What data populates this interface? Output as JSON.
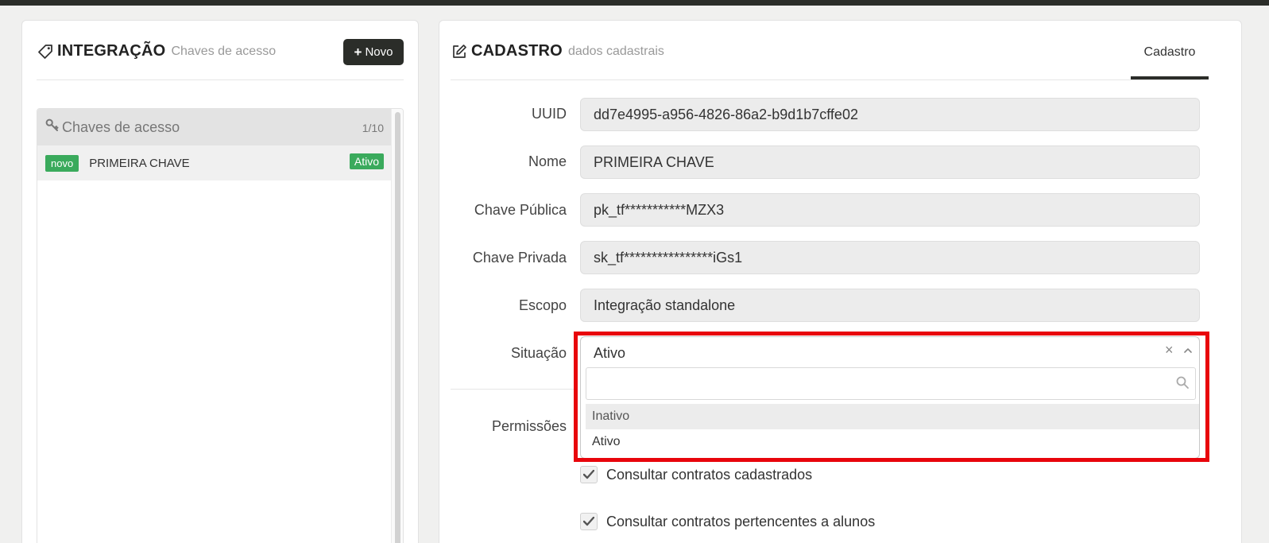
{
  "integracao": {
    "title": "INTEGRAÇÃO",
    "subtitle": "Chaves de acesso",
    "new_button": "Novo",
    "list": {
      "header": "Chaves de acesso",
      "count": "1/10",
      "items": [
        {
          "badge": "novo",
          "label": "PRIMEIRA CHAVE",
          "status": "Ativo"
        }
      ]
    }
  },
  "cadastro": {
    "title": "CADASTRO",
    "subtitle": "dados cadastrais",
    "tab": "Cadastro",
    "fields": {
      "uuid": {
        "label": "UUID",
        "value": "dd7e4995-a956-4826-86a2-b9d1b7cffe02"
      },
      "nome": {
        "label": "Nome",
        "value": "PRIMEIRA CHAVE"
      },
      "chave_publica": {
        "label": "Chave Pública",
        "value": "pk_tf***********MZX3"
      },
      "chave_privada": {
        "label": "Chave Privada",
        "value": "sk_tf****************iGs1"
      },
      "escopo": {
        "label": "Escopo",
        "value": "Integração standalone"
      },
      "situacao": {
        "label": "Situação",
        "value": "Ativo",
        "search_placeholder": "",
        "options": [
          "Inativo",
          "Ativo"
        ]
      }
    },
    "permissoes": {
      "label": "Permissões",
      "items": [
        {
          "label": "Consultar contratos cadastrados",
          "checked": true
        },
        {
          "label": "Consultar contratos pertencentes a alunos",
          "checked": true
        }
      ]
    }
  },
  "colors": {
    "dark": "#2b2d29",
    "green": "#3aaa5c",
    "highlight_red": "#e8050c",
    "input_bg": "#ececec"
  },
  "icons": {
    "integracao": "tag-icon",
    "cadastro": "edit-icon",
    "list_header": "key-icon",
    "new_button": "plus-icon",
    "select_clear": "close-icon",
    "select_toggle": "chevron-up-icon",
    "search": "search-icon",
    "checkbox": "check-icon"
  }
}
